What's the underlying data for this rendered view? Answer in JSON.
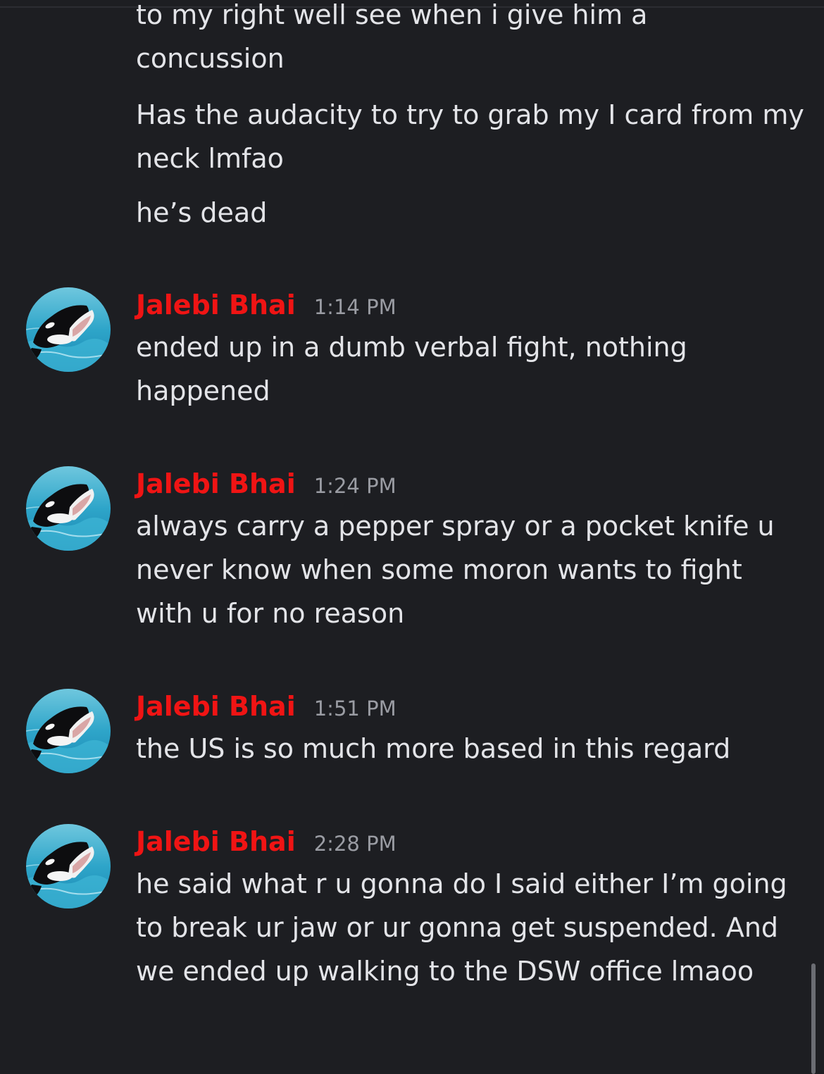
{
  "continued_messages": [
    "to my right well see when i give him a\nconcussion",
    "Has the audacity to try to grab my I card from my neck lmfao",
    "he’s dead"
  ],
  "messages": [
    {
      "username": "Jalebi Bhai",
      "timestamp": "1:14 PM",
      "text": "ended up in a dumb verbal fight, nothing happened",
      "avatar": "orca-avatar"
    },
    {
      "username": "Jalebi Bhai",
      "timestamp": "1:24 PM",
      "text": "always carry a pepper spray or a pocket knife u never know when some moron wants to fight with u for no reason",
      "avatar": "orca-avatar"
    },
    {
      "username": "Jalebi Bhai",
      "timestamp": "1:51 PM",
      "text": "the US is so much more based in this regard",
      "avatar": "orca-avatar"
    },
    {
      "username": "Jalebi Bhai",
      "timestamp": "2:28 PM",
      "text": "he said what r u gonna do I said either I’m going to break ur jaw or ur gonna get suspended. And we ended up walking to the DSW office lmaoo",
      "avatar": "orca-avatar"
    }
  ],
  "colors": {
    "background": "#1d1e22",
    "username": "#f01414",
    "message_text": "#e3e4e8",
    "timestamp": "#9a9ca3"
  }
}
